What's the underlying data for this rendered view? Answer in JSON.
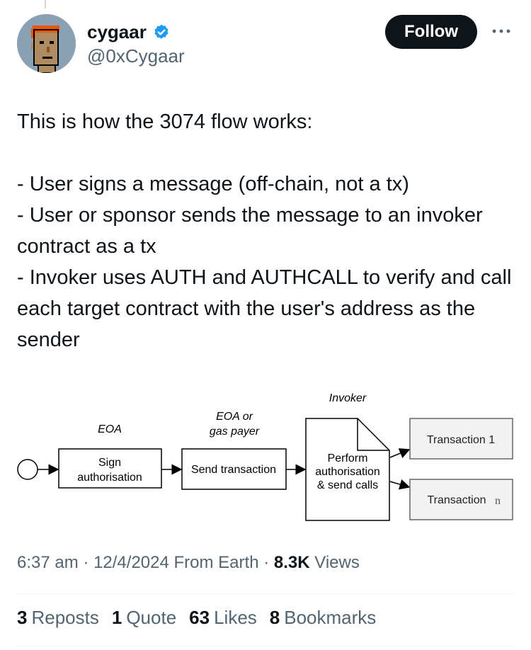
{
  "author": {
    "display_name": "cygaar",
    "handle": "@0xCygaar",
    "verified": true,
    "accent_color": "#1d9bf0"
  },
  "actions": {
    "follow_label": "Follow",
    "more_icon": "more-horizontal-icon"
  },
  "tweet": {
    "paragraphs": [
      "This is how the 3074 flow works:",
      "- User signs a message (off-chain, not a tx)\n- User or sponsor sends the message to an invoker contract as a tx\n- Invoker uses AUTH and AUTHCALL to verify and call each target contract with the user's address as the sender"
    ]
  },
  "diagram": {
    "lanes": {
      "eoa": "EOA",
      "eoa_or_line1": "EOA or",
      "eoa_or_line2": "gas payer",
      "invoker": "Invoker"
    },
    "steps": {
      "sign_line1": "Sign",
      "sign_line2": "authorisation",
      "send": "Send transaction",
      "perform_line1": "Perform",
      "perform_line2": "authorisation",
      "perform_line3": "& send calls"
    },
    "outputs": {
      "tx1": "Transaction 1",
      "txn_prefix": "Transaction",
      "txn_suffix": "n"
    }
  },
  "meta": {
    "time": "6:37 am",
    "separator": "·",
    "date": "12/4/2024",
    "source": "From Earth",
    "views_count": "8.3K",
    "views_label": "Views"
  },
  "stats": {
    "reposts_count": "3",
    "reposts_label": "Reposts",
    "quotes_count": "1",
    "quotes_label": "Quote",
    "likes_count": "63",
    "likes_label": "Likes",
    "bookmarks_count": "8",
    "bookmarks_label": "Bookmarks"
  }
}
